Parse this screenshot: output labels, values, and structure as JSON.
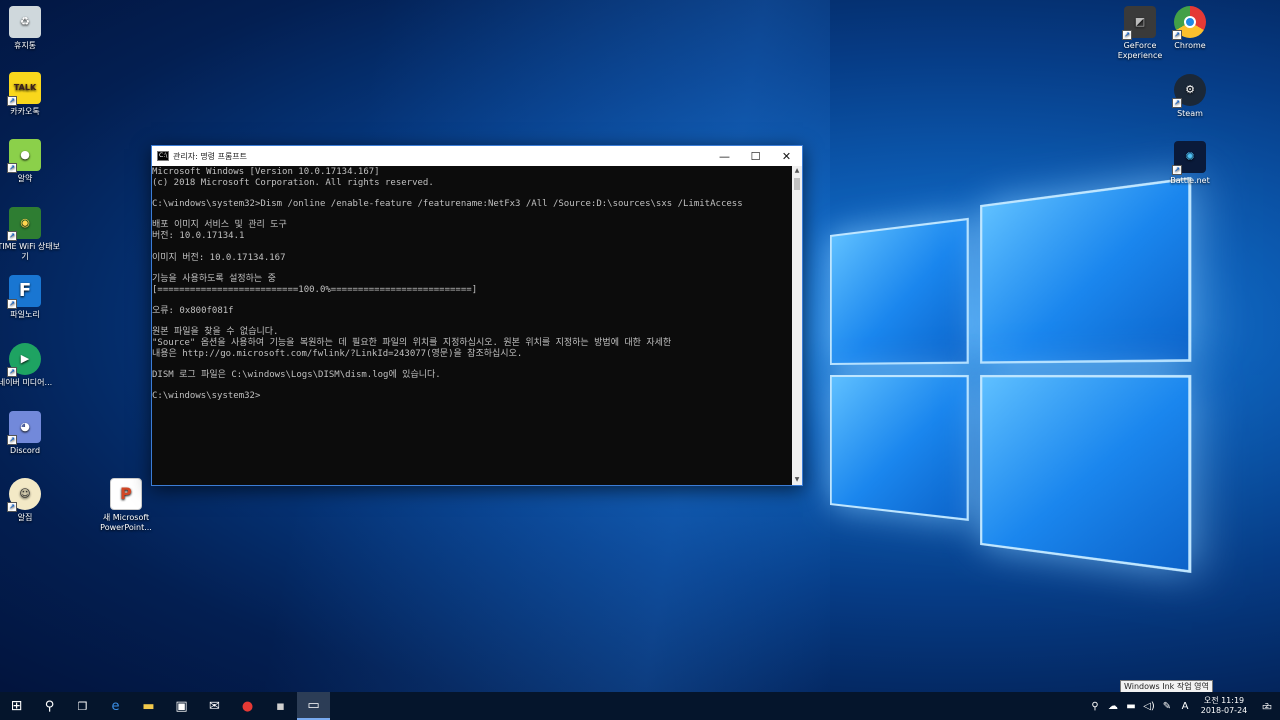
{
  "desktop_icons": [
    {
      "label": "휴지통",
      "icon": "recycle-bin-icon",
      "color": "#d8d8d8"
    },
    {
      "label": "카카오톡",
      "icon": "kakaotalk-icon",
      "color": "#f9d71c",
      "text": "TALK"
    },
    {
      "label": "알약",
      "icon": "alyac-icon",
      "color": "#8bd04a"
    },
    {
      "label": "ipTIME WiFi 상태보기",
      "icon": "iptime-wifi-icon",
      "color": "#2e7d32"
    },
    {
      "label": "파일노리",
      "icon": "filenori-icon",
      "color": "#1976d2",
      "text": "F"
    },
    {
      "label": "네이버 미디어...",
      "icon": "naver-media-icon",
      "color": "#1ea362"
    },
    {
      "label": "Discord",
      "icon": "discord-icon",
      "color": "#7289da"
    },
    {
      "label": "알집",
      "icon": "alzip-icon",
      "color": "#f3e9c6"
    },
    {
      "label": "새 Microsoft PowerPoint...",
      "icon": "powerpoint-file-icon",
      "color": "#d24726"
    },
    {
      "label": "GeForce Experience",
      "icon": "geforce-icon",
      "color": "#3a3a3a"
    },
    {
      "label": "Chrome",
      "icon": "chrome-icon",
      "color": "#e53935"
    },
    {
      "label": "Steam",
      "icon": "steam-icon",
      "color": "#1b2838"
    },
    {
      "label": "Battle.net",
      "icon": "battlenet-icon",
      "color": "#0a1a3a"
    }
  ],
  "cmd": {
    "title": "관리자: 명령 프롬프트",
    "lines": [
      "Microsoft Windows [Version 10.0.17134.167]",
      "(c) 2018 Microsoft Corporation. All rights reserved.",
      "",
      "C:\\windows\\system32>Dism /online /enable-feature /featurename:NetFx3 /All /Source:D:\\sources\\sxs /LimitAccess",
      "",
      "배포 이미지 서비스 및 관리 도구",
      "버전: 10.0.17134.1",
      "",
      "이미지 버전: 10.0.17134.167",
      "",
      "기능을 사용하도록 설정하는 중",
      "[==========================100.0%==========================]",
      "",
      "오류: 0x800f081f",
      "",
      "원본 파일을 찾을 수 없습니다.",
      "\"Source\" 옵션을 사용하여 기능을 복원하는 데 필요한 파일의 위치를 지정하십시오. 원본 위치를 지정하는 방법에 대한 자세한",
      "내용은 http://go.microsoft.com/fwlink/?LinkId=243077(영문)을 참조하십시오.",
      "",
      "DISM 로그 파일은 C:\\windows\\Logs\\DISM\\dism.log에 있습니다.",
      "",
      "C:\\windows\\system32>"
    ],
    "minimize": "—",
    "maximize": "☐",
    "close": "✕"
  },
  "tooltip": "Windows Ink 작업 영역",
  "taskbar": {
    "start": "⊞",
    "search": "⚲",
    "taskview": "❐",
    "apps": [
      {
        "name": "edge-icon",
        "glyph": "e",
        "color": "#3a8ee6"
      },
      {
        "name": "file-explorer-icon",
        "glyph": "▬",
        "color": "#f2c94c"
      },
      {
        "name": "store-icon",
        "glyph": "▣",
        "color": "#ffffff"
      },
      {
        "name": "mail-icon",
        "glyph": "✉",
        "color": "#ffffff"
      },
      {
        "name": "chrome-icon",
        "glyph": "●",
        "color": "#e53935"
      },
      {
        "name": "smart-app-icon",
        "glyph": "▪",
        "color": "#d0d0d0"
      },
      {
        "name": "command-prompt-icon",
        "glyph": "▭",
        "color": "#ffffff"
      }
    ],
    "tray_icons": [
      "⚲",
      "☁",
      "▬",
      "◁)",
      "✎",
      "A"
    ],
    "clock_ampm_time": "오전 11:19",
    "clock_date": "2018-07-24",
    "notification_count": "2"
  }
}
